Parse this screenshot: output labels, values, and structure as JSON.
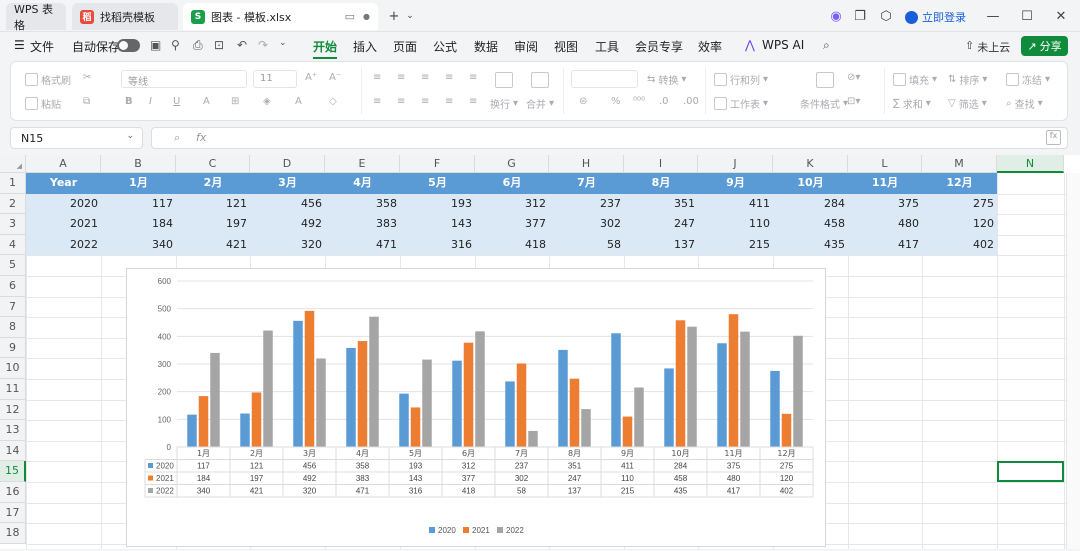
{
  "tabs": [
    {
      "label": "WPS 表格"
    },
    {
      "label": "找稻壳模板"
    },
    {
      "label": "图表 - 模板.xlsx"
    }
  ],
  "window": {
    "login": "立即登录"
  },
  "menu": {
    "file": "文件",
    "autosave": "自动保存",
    "items": [
      "开始",
      "插入",
      "页面",
      "公式",
      "数据",
      "审阅",
      "视图",
      "工具",
      "会员专享",
      "效率",
      "WPS AI"
    ],
    "cloud": "未上云",
    "share": "分享"
  },
  "ribbon": {
    "format_painter": "格式刷",
    "paste": "粘贴",
    "font": "等线",
    "size": "11",
    "wrap": "换行",
    "merge": "合并",
    "convert": "转换",
    "rowcol": "行和列",
    "worksheet": "工作表",
    "cond_format": "条件格式",
    "fill": "填充",
    "sort": "排序",
    "freeze": "冻结",
    "sum": "求和",
    "filter": "筛选",
    "find": "查找"
  },
  "namebox": "N15",
  "columns": [
    "A",
    "B",
    "C",
    "D",
    "E",
    "F",
    "G",
    "H",
    "I",
    "J",
    "K",
    "L",
    "M",
    "N"
  ],
  "rows": [
    "1",
    "2",
    "3",
    "4",
    "5",
    "6",
    "7",
    "8",
    "9",
    "10",
    "11",
    "12",
    "13",
    "14",
    "15",
    "16",
    "17",
    "18"
  ],
  "table": {
    "header": [
      "Year",
      "1月",
      "2月",
      "3月",
      "4月",
      "5月",
      "6月",
      "7月",
      "8月",
      "9月",
      "10月",
      "11月",
      "12月"
    ],
    "rows": [
      [
        "2020",
        "117",
        "121",
        "456",
        "358",
        "193",
        "312",
        "237",
        "351",
        "411",
        "284",
        "375",
        "275"
      ],
      [
        "2021",
        "184",
        "197",
        "492",
        "383",
        "143",
        "377",
        "302",
        "247",
        "110",
        "458",
        "480",
        "120"
      ],
      [
        "2022",
        "340",
        "421",
        "320",
        "471",
        "316",
        "418",
        "58",
        "137",
        "215",
        "435",
        "417",
        "402"
      ]
    ]
  },
  "colors": {
    "accent": "#0f8b3b",
    "header_fill": "#5b9bd5",
    "row_fill": "#dbe9f7",
    "s2020": "#5b9bd5",
    "s2021": "#ed7d31",
    "s2022": "#a5a5a5"
  },
  "chart_data": {
    "type": "bar",
    "categories": [
      "1月",
      "2月",
      "3月",
      "4月",
      "5月",
      "6月",
      "7月",
      "8月",
      "9月",
      "10月",
      "11月",
      "12月"
    ],
    "series": [
      {
        "name": "2020",
        "values": [
          117,
          121,
          456,
          358,
          193,
          312,
          237,
          351,
          411,
          284,
          375,
          275
        ]
      },
      {
        "name": "2021",
        "values": [
          184,
          197,
          492,
          383,
          143,
          377,
          302,
          247,
          110,
          458,
          480,
          120
        ]
      },
      {
        "name": "2022",
        "values": [
          340,
          421,
          320,
          471,
          316,
          418,
          58,
          137,
          215,
          435,
          417,
          402
        ]
      }
    ],
    "ylim": [
      0,
      600
    ],
    "yticks": [
      0,
      100,
      200,
      300,
      400,
      500,
      600
    ],
    "legend": "bottom",
    "data_table": true
  }
}
